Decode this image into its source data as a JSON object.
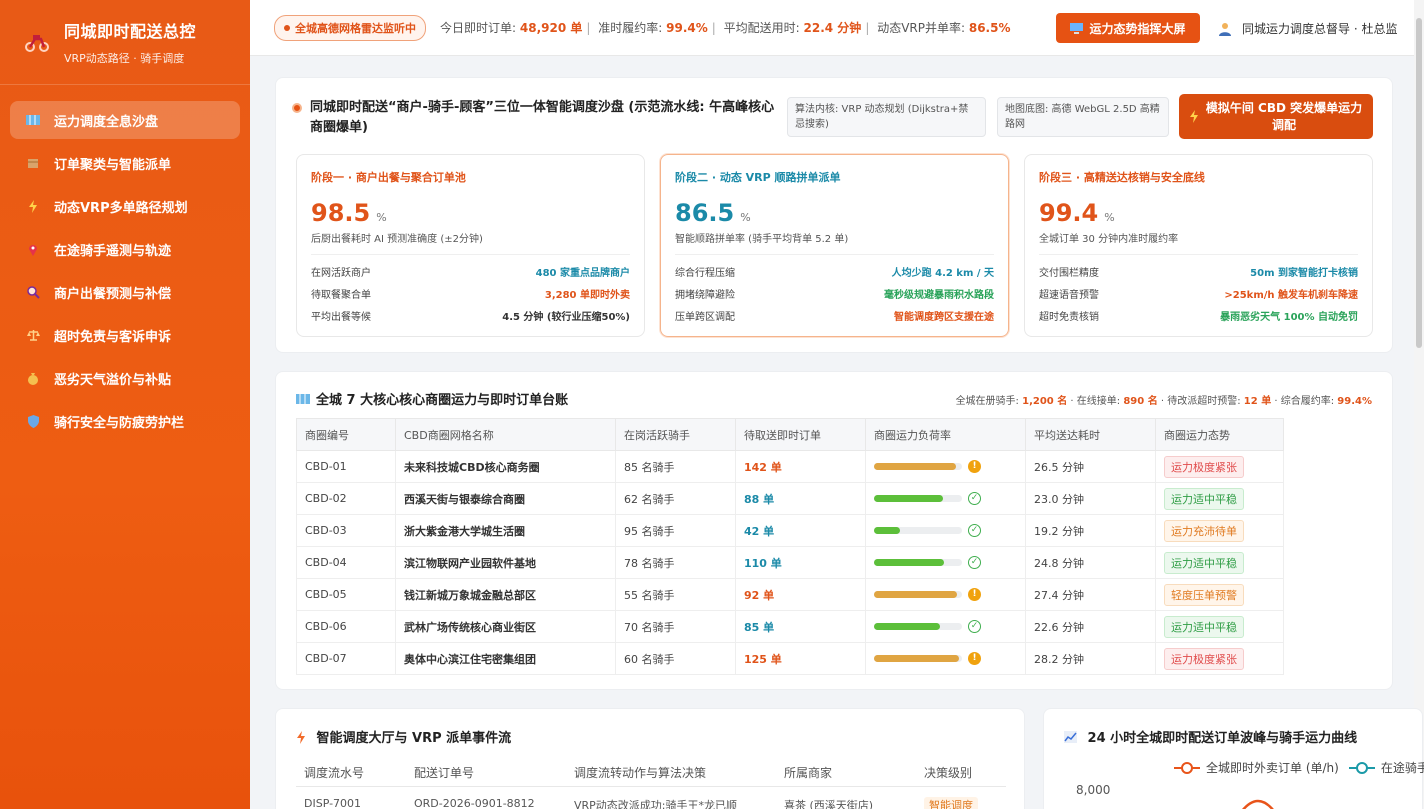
{
  "brand": {
    "title": "同城即时配送总控",
    "subtitle": "VRP动态路径 · 骑手调度"
  },
  "nav": [
    {
      "label": "运力调度全息沙盘",
      "icon": "map-icon",
      "active": true
    },
    {
      "label": "订单聚类与智能派单",
      "icon": "package-icon"
    },
    {
      "label": "动态VRP多单路径规划",
      "icon": "lightning-icon"
    },
    {
      "label": "在途骑手遥测与轨迹",
      "icon": "location-pin-icon"
    },
    {
      "label": "商户出餐预测与补偿",
      "icon": "magnifier-icon"
    },
    {
      "label": "超时免责与客诉申诉",
      "icon": "scale-icon"
    },
    {
      "label": "恶劣天气溢价与补贴",
      "icon": "money-bag-icon"
    },
    {
      "label": "骑行安全与防疲劳护栏",
      "icon": "shield-icon"
    }
  ],
  "topbar": {
    "badge": "全城高德网格雷达监听中",
    "m1_label": "今日即时订单:",
    "m1_value": "48,920 单",
    "m2_label": "准时履约率:",
    "m2_value": "99.4%",
    "m3_label": "平均配送用时:",
    "m3_value": "22.4 分钟",
    "m4_label": "动态VRP并单率:",
    "m4_value": "86.5%",
    "sep": "|",
    "command_button": "运力态势指挥大屏",
    "user": "同城运力调度总督导 · 杜总监"
  },
  "sandbox": {
    "title": "同城即时配送“商户-骑手-顾客”三位一体智能调度沙盘 (示范流水线: 午高峰核心商圈爆单)",
    "tag1": "算法内核: VRP 动态规划 (Dijkstra+禁忌搜索)",
    "tag2": "地图底图: 高德 WebGL 2.5D 高精路网",
    "simulate_button": "模拟午间 CBD 突发爆单运力调配",
    "stages": [
      {
        "label": "阶段一 · 商户出餐与聚合订单池",
        "value": "98.5",
        "unit": "%",
        "desc": "后厨出餐耗时 AI 预测准确度 (±2分钟)",
        "rows": [
          {
            "k": "在网活跃商户",
            "v": "480 家重点品牌商户",
            "c": "teal"
          },
          {
            "k": "待取餐聚合单",
            "v": "3,280 单即时外卖",
            "c": "orange"
          },
          {
            "k": "平均出餐等候",
            "v": "4.5 分钟 (较行业压缩50%)",
            "c": "grey"
          }
        ]
      },
      {
        "label": "阶段二 · 动态 VRP 顺路拼单派单",
        "value": "86.5",
        "unit": "%",
        "desc": "智能顺路拼单率 (骑手平均背单 5.2 单)",
        "rows": [
          {
            "k": "综合行程压缩",
            "v": "人均少跑 4.2 km / 天",
            "c": "teal"
          },
          {
            "k": "拥堵绕障避险",
            "v": "毫秒级规避暴雨积水路段",
            "c": "green"
          },
          {
            "k": "压单跨区调配",
            "v": "智能调度跨区支援在途",
            "c": "orange"
          }
        ]
      },
      {
        "label": "阶段三 · 高精送达核销与安全底线",
        "value": "99.4",
        "unit": "%",
        "desc": "全城订单 30 分钟内准时履约率",
        "rows": [
          {
            "k": "交付围栏精度",
            "v": "50m 到家智能打卡核销",
            "c": "teal"
          },
          {
            "k": "超速语音预警",
            "v": ">25km/h 触发车机刹车降速",
            "c": "red"
          },
          {
            "k": "超时免责核销",
            "v": "暴雨恶劣天气 100% 自动免罚",
            "c": "green"
          }
        ]
      }
    ]
  },
  "ledger": {
    "title": "全城 7 大核心核心商圈运力与即时订单台账",
    "summary": {
      "s1": "全城在册骑手: ",
      "v1": "1,200 名",
      "s2": " · 在线接单: ",
      "v2": "890 名",
      "s3": " · 待改派超时预警: ",
      "v3": "12 单",
      "s4": " · 综合履约率: ",
      "v4": "99.4%"
    },
    "columns": [
      "商圈编号",
      "CBD商圈网格名称",
      "在岗活跃骑手",
      "待取送即时订单",
      "商圈运力负荷率",
      "平均送达耗时",
      "商圈运力态势"
    ],
    "rows": [
      {
        "id": "CBD-01",
        "name": "未来科技城CBD核心商务圈",
        "riders": "85 名骑手",
        "orders": "142 单",
        "load": 0.93,
        "status_icon": "warn",
        "time": "26.5 分钟",
        "state": "运力极度紧张",
        "tone": "red"
      },
      {
        "id": "CBD-02",
        "name": "西溪天街与银泰综合商圈",
        "riders": "62 名骑手",
        "orders": "88 单",
        "load": 0.78,
        "status_icon": "ok",
        "time": "23.0 分钟",
        "state": "运力适中平稳",
        "tone": "green"
      },
      {
        "id": "CBD-03",
        "name": "浙大紫金港大学城生活圈",
        "riders": "95 名骑手",
        "orders": "42 单",
        "load": 0.29,
        "status_icon": "ok",
        "time": "19.2 分钟",
        "state": "运力充沛待单",
        "tone": "amber"
      },
      {
        "id": "CBD-04",
        "name": "滨江物联网产业园软件基地",
        "riders": "78 名骑手",
        "orders": "110 单",
        "load": 0.8,
        "status_icon": "ok",
        "time": "24.8 分钟",
        "state": "运力适中平稳",
        "tone": "green"
      },
      {
        "id": "CBD-05",
        "name": "钱江新城万象城金融总部区",
        "riders": "55 名骑手",
        "orders": "92 单",
        "load": 0.94,
        "status_icon": "warn",
        "time": "27.4 分钟",
        "state": "轻度压单预警",
        "tone": "amber"
      },
      {
        "id": "CBD-06",
        "name": "武林广场传统核心商业街区",
        "riders": "70 名骑手",
        "orders": "85 单",
        "load": 0.75,
        "status_icon": "ok",
        "time": "22.6 分钟",
        "state": "运力适中平稳",
        "tone": "green"
      },
      {
        "id": "CBD-07",
        "name": "奥体中心滨江住宅密集组团",
        "riders": "60 名骑手",
        "orders": "125 单",
        "load": 0.97,
        "status_icon": "warn",
        "time": "28.2 分钟",
        "state": "运力极度紧张",
        "tone": "red"
      }
    ]
  },
  "events": {
    "title": "智能调度大厅与 VRP 派单事件流",
    "columns": [
      "调度流水号",
      "配送订单号",
      "调度流转动作与算法决策",
      "所属商家",
      "决策级别"
    ],
    "row": [
      "DISP-7001",
      "ORD-2026-0901-8812",
      "VRP动态改派成功:骑手王*龙已顺",
      "喜茶 (西溪天街店)",
      "智能调度"
    ]
  },
  "curve": {
    "title": "24 小时全城即时配送订单波峰与骑手运力曲线",
    "legend1": "全城即时外卖订单 (单/h)",
    "legend2": "在途骑手",
    "y_tick": "8,000",
    "color1": "#e8541a",
    "color2": "#1b9aa8"
  }
}
